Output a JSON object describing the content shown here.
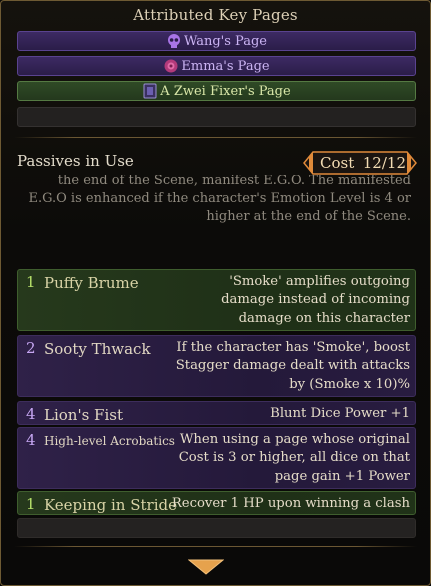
{
  "key_pages": {
    "title": "Attributed Key Pages",
    "pages": [
      {
        "label": "Wang's Page",
        "icon": "skull-icon",
        "color": "#b48be8"
      },
      {
        "label": "Emma's Page",
        "icon": "rose-icon",
        "color": "#b48be8"
      },
      {
        "label": "A Zwei Fixer's Page",
        "icon": "card-icon",
        "color": "#c8dc8a"
      }
    ]
  },
  "passives": {
    "header": "Passives in Use",
    "cost_label": "Cost",
    "cost_value": "12/12",
    "overflow_text": "the end of the Scene, manifest E.G.O. The manifested E.G.O is enhanced if the character's Emotion Level is 4 or higher at the end of the Scene.",
    "items": [
      {
        "cost": "1",
        "name": "Puffy Brume",
        "desc": "'Smoke' amplifies outgoing damage instead of incoming damage on this character",
        "rarity": "green"
      },
      {
        "cost": "2",
        "name": "Sooty Thwack",
        "desc": "If the character has 'Smoke', boost Stagger damage dealt with attacks by (Smoke x 10)%",
        "rarity": "purple"
      },
      {
        "cost": "4",
        "name": "Lion's Fist",
        "desc": "Blunt Dice Power +1",
        "rarity": "purple"
      },
      {
        "cost": "4",
        "name": "High-level Acrobatics",
        "desc": "When using a page whose original Cost is 3 or higher, all dice on that page gain +1 Power",
        "rarity": "purple"
      },
      {
        "cost": "1",
        "name": "Keeping in Stride",
        "desc": "Recover 1 HP upon winning a clash",
        "rarity": "green"
      }
    ]
  },
  "colors": {
    "frame_gold": "#6e5a33",
    "cost_orange": "#e08a3a",
    "green_accent": "#b6e06a",
    "purple_accent": "#c6a6f2"
  }
}
